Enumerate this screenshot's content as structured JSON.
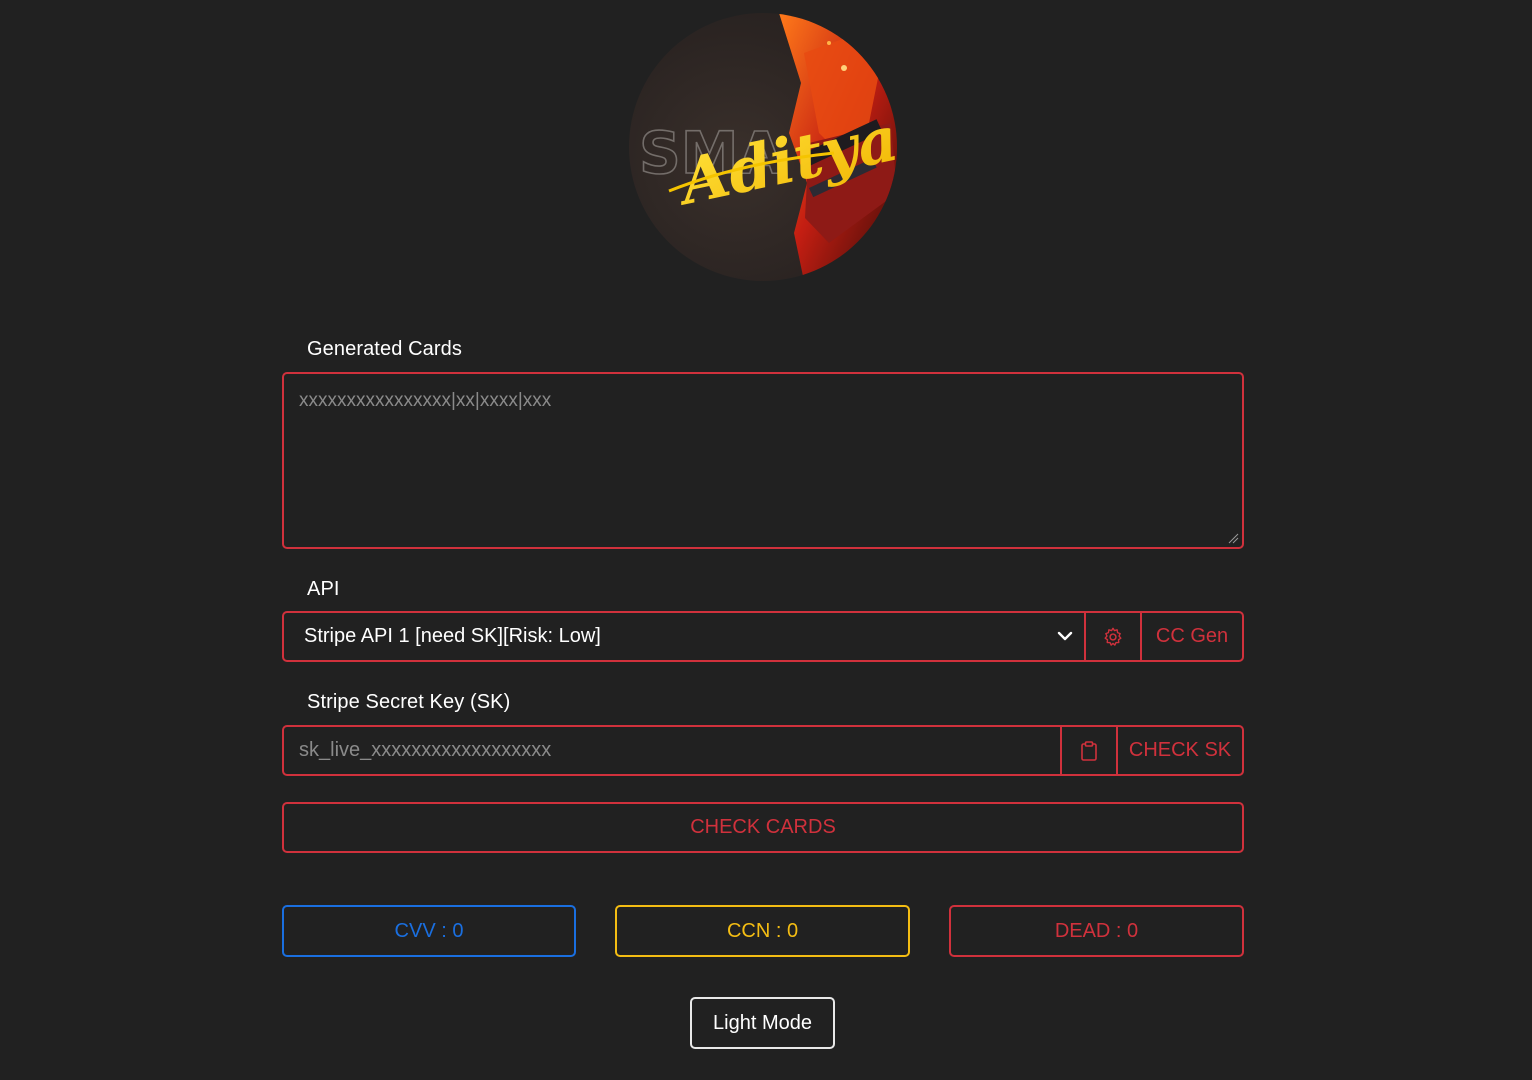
{
  "logo": {
    "text": "Aditya",
    "bg_text": "SMA"
  },
  "generated_cards": {
    "label": "Generated Cards",
    "placeholder": "xxxxxxxxxxxxxxxx|xx|xxxx|xxx",
    "value": ""
  },
  "api": {
    "label": "API",
    "selected": "Stripe API 1 [need SK][Risk: Low]",
    "settings_icon": "gear-icon",
    "cc_gen_label": "CC Gen"
  },
  "sk": {
    "label": "Stripe Secret Key (SK)",
    "placeholder": "sk_live_xxxxxxxxxxxxxxxxxx",
    "value": "",
    "paste_icon": "clipboard-icon",
    "check_label": "CHECK SK"
  },
  "check_cards_label": "CHECK CARDS",
  "stats": {
    "cvv": "CVV : 0",
    "ccn": "CCN : 0",
    "dead": "DEAD : 0"
  },
  "theme_toggle_label": "Light Mode",
  "colors": {
    "background": "#212121",
    "accent_red": "#d0313c",
    "accent_blue": "#1a6fe0",
    "accent_yellow": "#f4bd13"
  }
}
